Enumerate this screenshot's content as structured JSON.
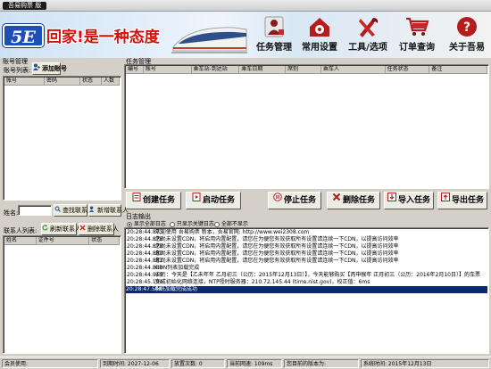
{
  "window": {
    "title": "吾易购票    版"
  },
  "banner": {
    "logo": "5E",
    "slogan": "回家!是一种态度",
    "menu": [
      {
        "label": "任务管理",
        "icon": "person-task-icon"
      },
      {
        "label": "常用设置",
        "icon": "settings-house-icon"
      },
      {
        "label": "工具/选项",
        "icon": "tools-icon"
      },
      {
        "label": "订单查询",
        "icon": "shopping-cart-icon"
      },
      {
        "label": "关于吾易",
        "icon": "help-question-icon"
      }
    ]
  },
  "accounts": {
    "group": "账号管理",
    "list_label": "账号列表:",
    "add_button": "添加账号",
    "columns": [
      "账号",
      "密码",
      "状态",
      "人数"
    ]
  },
  "contacts": {
    "name_label": "姓名:",
    "name_value": "",
    "search_button": "查找联系人",
    "new_button": "新增联系人",
    "list_label": "联系人列表:",
    "refresh_button": "刷新联系人",
    "delete_button": "删除联系人",
    "columns": [
      "姓名",
      "证件号",
      "状态"
    ]
  },
  "tasks": {
    "group": "任务管理",
    "columns": [
      "编号",
      "账号",
      "乘车站-到达站",
      "乘车日期",
      "席别",
      "乘车人",
      "任务状态",
      "备注"
    ],
    "buttons": {
      "create": "创建任务",
      "start": "启动任务",
      "stop": "停止任务",
      "delete": "删除任务",
      "import": "导入任务",
      "export": "导出任务"
    }
  },
  "log": {
    "group": "日志输出",
    "filters": [
      {
        "label": "显示全部日志",
        "selected": true
      },
      {
        "label": "只显示关键日志",
        "selected": false
      },
      {
        "label": "全部不显示",
        "selected": false
      }
    ],
    "lines": [
      {
        "time": "20:28:44.873",
        "text": "欢迎使用 吾易购票 新本，吾易官网: http://www.wei2308.com"
      },
      {
        "time": "20:28:44.876",
        "text": "您尚未设置CDN，将启用内置配置，请您在为便您有效获取所有设置请连续一下CDN，以提高访问效率"
      },
      {
        "time": "20:28:44.878",
        "text": "您尚未设置CDN，将启用内置配置，请您在为便您有效获取所有设置请连续一下CDN，以提高访问效率"
      },
      {
        "time": "20:28:44.880",
        "text": "您尚未设置CDN，将启用内置配置，请您在为便您有效获取所有设置请连续一下CDN，以提高访问效率"
      },
      {
        "time": "20:28:44.881",
        "text": "您尚未设置CDN，将启用内置配置，请您在为便您有效获取所有设置请连续一下CDN，以提高访问效率"
      },
      {
        "time": "20:28:44.888",
        "text": "CDN列表加载完成"
      },
      {
        "time": "20:28:44.919",
        "text": "农历：今天是【乙未年年 乙月初三（公历：2015年12月13日）】，今天能够购买【丙申猴年 正月初三（公历：2016年2月10日）】的车票"
      },
      {
        "time": "20:28:45.194",
        "text": "完成初始化网络连接，NTP授时服务器：210.72.145.44 (time.nist.gov)，校正值：6ms"
      },
      {
        "time": "20:28:47.548",
        "text": "系统加载完成成功"
      }
    ],
    "selected_index": 8
  },
  "status": {
    "user_label": "会员使用:",
    "expire": "到期时间: 2027-12-06",
    "queries": "放置次数: 0",
    "latency": "当前网速: 109ms",
    "version": "您目前的版本为:",
    "systime": "系统时间: 2015年12月13日"
  }
}
